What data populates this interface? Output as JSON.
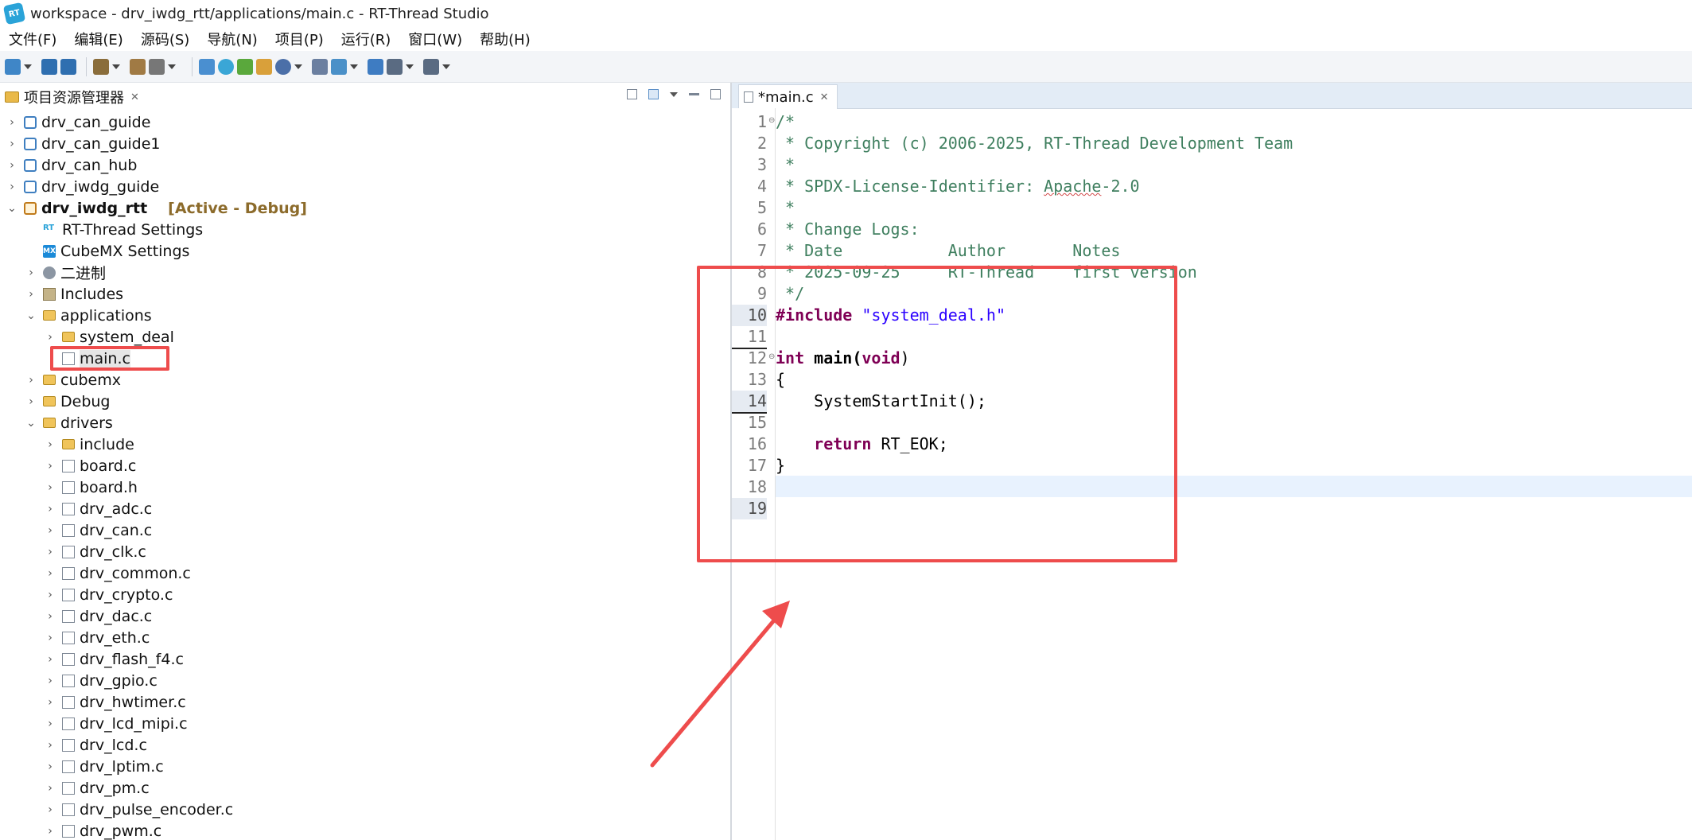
{
  "window": {
    "title": "workspace - drv_iwdg_rtt/applications/main.c - RT-Thread Studio",
    "logo_text": "RT"
  },
  "menu": [
    "文件(F)",
    "编辑(E)",
    "源码(S)",
    "导航(N)",
    "项目(P)",
    "运行(R)",
    "窗口(W)",
    "帮助(H)"
  ],
  "left_panel": {
    "title": "项目资源管理器",
    "tree": [
      {
        "label": "drv_can_guide",
        "icon": "project-icon"
      },
      {
        "label": "drv_can_guide1",
        "icon": "project-icon"
      },
      {
        "label": "drv_can_hub",
        "icon": "project-icon"
      },
      {
        "label": "drv_iwdg_guide",
        "icon": "project-icon"
      },
      {
        "label": "drv_iwdg_rtt",
        "icon": "project-icon",
        "tag": "[Active - Debug]"
      },
      {
        "label": "RT-Thread Settings",
        "icon": "rt-settings-icon"
      },
      {
        "label": "CubeMX Settings",
        "icon": "cubemx-icon"
      },
      {
        "label": "二进制",
        "icon": "binaries-icon"
      },
      {
        "label": "Includes",
        "icon": "includes-icon"
      },
      {
        "label": "applications",
        "icon": "folder-icon"
      },
      {
        "label": "system_deal",
        "icon": "folder-icon"
      },
      {
        "label": "main.c",
        "icon": "c-file-icon"
      },
      {
        "label": "cubemx",
        "icon": "folder-icon"
      },
      {
        "label": "Debug",
        "icon": "folder-icon"
      },
      {
        "label": "drivers",
        "icon": "folder-icon"
      },
      {
        "label": "include",
        "icon": "folder-icon"
      },
      {
        "label": "board.c",
        "icon": "c-file-icon"
      },
      {
        "label": "board.h",
        "icon": "h-file-icon"
      },
      {
        "label": "drv_adc.c",
        "icon": "c-file-icon"
      },
      {
        "label": "drv_can.c",
        "icon": "c-file-icon"
      },
      {
        "label": "drv_clk.c",
        "icon": "c-file-icon"
      },
      {
        "label": "drv_common.c",
        "icon": "c-file-icon"
      },
      {
        "label": "drv_crypto.c",
        "icon": "c-file-icon"
      },
      {
        "label": "drv_dac.c",
        "icon": "c-file-icon"
      },
      {
        "label": "drv_eth.c",
        "icon": "c-file-icon"
      },
      {
        "label": "drv_flash_f4.c",
        "icon": "c-file-icon"
      },
      {
        "label": "drv_gpio.c",
        "icon": "c-file-icon"
      },
      {
        "label": "drv_hwtimer.c",
        "icon": "c-file-icon"
      },
      {
        "label": "drv_lcd_mipi.c",
        "icon": "c-file-icon"
      },
      {
        "label": "drv_lcd.c",
        "icon": "c-file-icon"
      },
      {
        "label": "drv_lptim.c",
        "icon": "c-file-icon"
      },
      {
        "label": "drv_pm.c",
        "icon": "c-file-icon"
      },
      {
        "label": "drv_pulse_encoder.c",
        "icon": "c-file-icon"
      },
      {
        "label": "drv_pwm.c",
        "icon": "c-file-icon"
      }
    ]
  },
  "editor": {
    "tab_label": "*main.c",
    "line_numbers": [
      "1",
      "2",
      "3",
      "4",
      "5",
      "6",
      "7",
      "8",
      "9",
      "10",
      "11",
      "12",
      "13",
      "14",
      "15",
      "16",
      "17",
      "18",
      "19"
    ],
    "code": {
      "l1": "/*",
      "l2": " * Copyright (c) 2006-2025, RT-Thread Development Team",
      "l3": " *",
      "l4a": " * SPDX-License-Identifier: ",
      "l4b": "Apache",
      "l4c": "-2.0",
      "l5": " *",
      "l6": " * Change Logs:",
      "l7": " * Date           Author       Notes",
      "l8": " * 2025-09-25     RT-Thread    first version",
      "l9": " */",
      "l10a": "#include ",
      "l10b": "\"system_deal.h\"",
      "l12a": "int",
      "l12b": " main(",
      "l12c": "void",
      "l12d": ")",
      "l13": "{",
      "l14": "    SystemStartInit();",
      "l16a": "    ",
      "l16b": "return",
      "l16c": " RT_EOK;",
      "l17": "}"
    }
  },
  "colors": {
    "annotation": "#ee4c4c",
    "keyword": "#7f0055",
    "comment": "#3f7f5f",
    "string": "#2a00ff"
  }
}
